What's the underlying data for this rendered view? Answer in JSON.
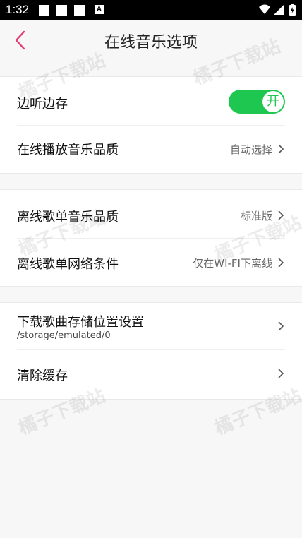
{
  "status": {
    "time": "1:32",
    "a_icon": "A"
  },
  "header": {
    "title": "在线音乐选项"
  },
  "section1": {
    "toggle_row": {
      "label": "边听边存",
      "toggle_text": "开",
      "on": true
    },
    "quality_row": {
      "label": "在线播放音乐品质",
      "value": "自动选择"
    }
  },
  "section2": {
    "offline_quality": {
      "label": "离线歌单音乐品质",
      "value": "标准版"
    },
    "offline_network": {
      "label": "离线歌单网络条件",
      "value": "仅在WI-FI下离线"
    }
  },
  "section3": {
    "storage": {
      "label": "下载歌曲存储位置设置",
      "path": "/storage/emulated/0"
    },
    "clear_cache": {
      "label": "清除缓存"
    }
  },
  "watermark": {
    "text": "橘子下载站"
  },
  "colors": {
    "accent_pink": "#e23a74",
    "toggle_green": "#1ec850"
  }
}
